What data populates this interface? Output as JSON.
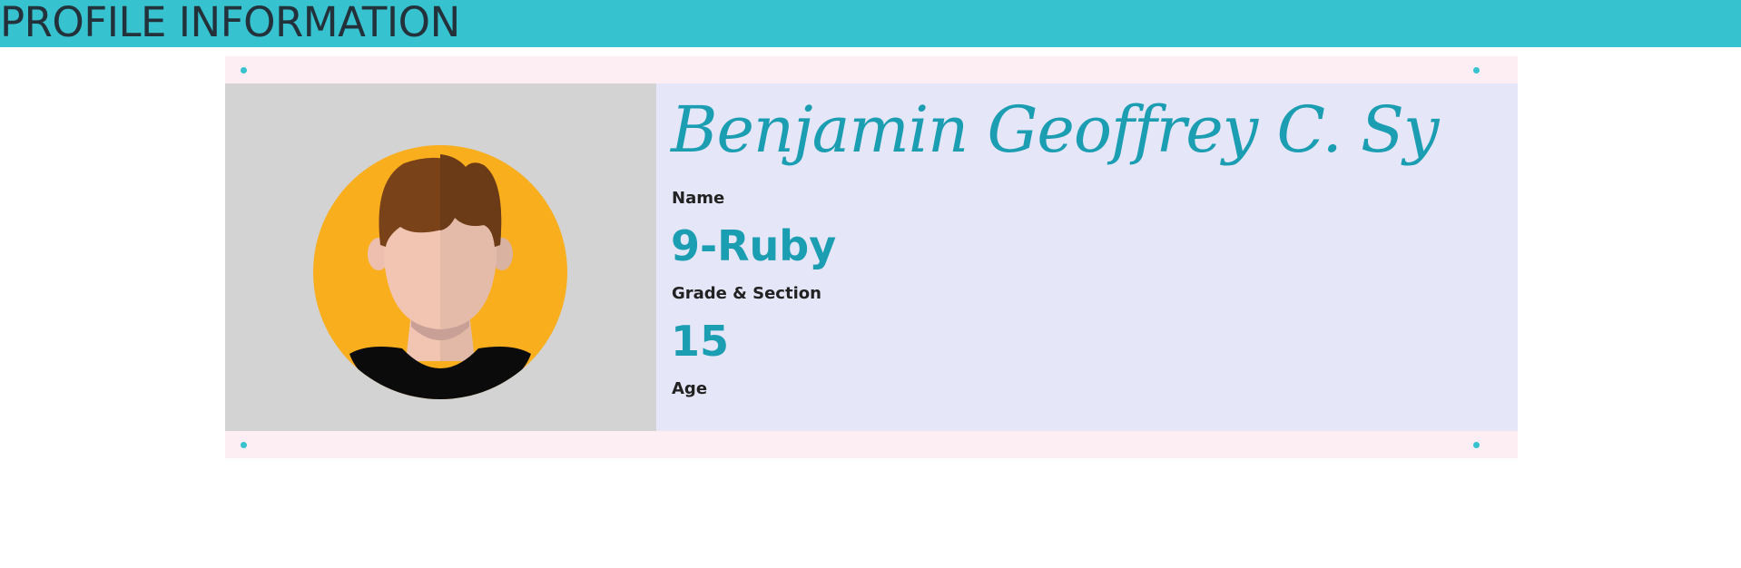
{
  "header": {
    "title": "PROFILE INFORMATION"
  },
  "profile": {
    "full_name": "Benjamin Geoffrey C. Sy",
    "name_label": "Name",
    "grade_section": "9-Ruby",
    "grade_section_label": "Grade & Section",
    "age": "15",
    "age_label": "Age",
    "avatar_icon": "person-avatar-icon"
  },
  "colors": {
    "accent": "#37c2cf",
    "value_text": "#1b9db2",
    "strip_background": "#fdeef4",
    "info_background": "#e6e6f9",
    "photo_background": "#d3d3d3",
    "avatar_circle": "#f9ae1d"
  }
}
